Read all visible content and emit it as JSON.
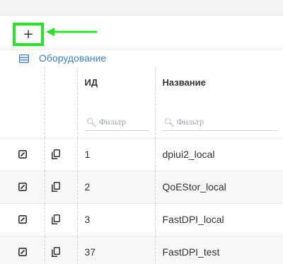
{
  "toolbar": {
    "add_label": "+"
  },
  "section": {
    "title": "Оборудование",
    "icon": "database-icon",
    "accent_color": "#3f82c7"
  },
  "table": {
    "columns": [
      {
        "key": "edit",
        "label": ""
      },
      {
        "key": "copy",
        "label": ""
      },
      {
        "key": "id",
        "label": "ИД",
        "filter_placeholder": "Фильтр"
      },
      {
        "key": "name",
        "label": "Название",
        "filter_placeholder": "Фильтр"
      }
    ],
    "rows": [
      {
        "id": "1",
        "name": "dpiui2_local"
      },
      {
        "id": "2",
        "name": "QoEStor_local"
      },
      {
        "id": "3",
        "name": "FastDPI_local"
      },
      {
        "id": "37",
        "name": "FastDPI_test"
      }
    ]
  },
  "annotation": {
    "highlight_color": "#27e327",
    "arrow_icon": "arrow-left-icon"
  }
}
